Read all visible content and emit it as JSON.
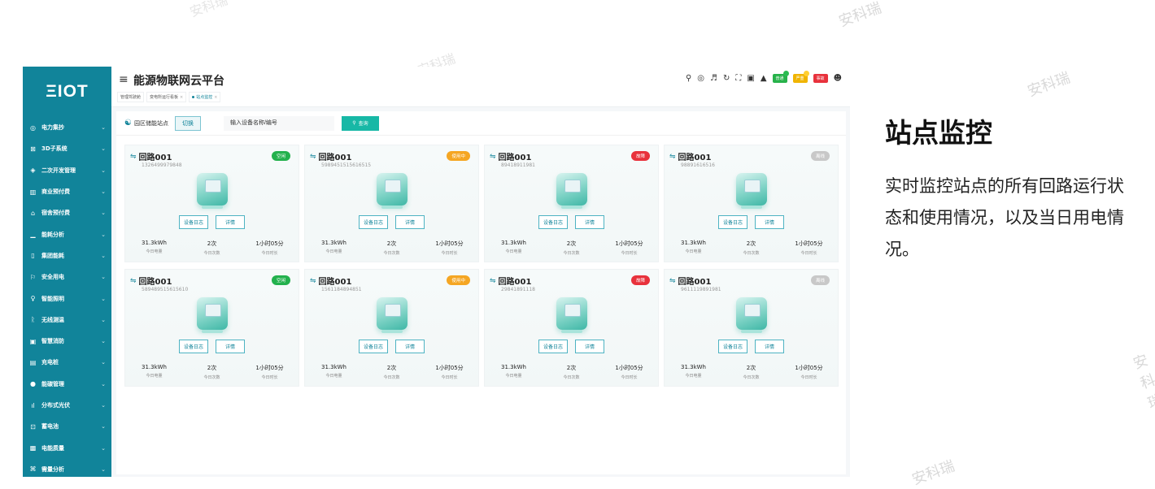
{
  "watermark": "安科瑞",
  "sidebar": {
    "logo": "ΞIOT",
    "items": [
      {
        "icon": "◎",
        "label": "电力集抄"
      },
      {
        "icon": "⊠",
        "label": "3D子系统"
      },
      {
        "icon": "◈",
        "label": "二次开发管理"
      },
      {
        "icon": "▥",
        "label": "商业预付费"
      },
      {
        "icon": "⌂",
        "label": "宿舍预付费"
      },
      {
        "icon": "▁",
        "label": "能耗分析"
      },
      {
        "icon": "▯",
        "label": "集团能耗"
      },
      {
        "icon": "⚐",
        "label": "安全用电"
      },
      {
        "icon": "♀",
        "label": "智能照明"
      },
      {
        "icon": "ᚱ",
        "label": "无线测温"
      },
      {
        "icon": "▣",
        "label": "智慧消防"
      },
      {
        "icon": "▤",
        "label": "充电桩"
      },
      {
        "icon": "●",
        "label": "能碳管理"
      },
      {
        "icon": "ıl",
        "label": "分布式光伏"
      },
      {
        "icon": "⊡",
        "label": "蓄电池"
      },
      {
        "icon": "▩",
        "label": "电能质量"
      },
      {
        "icon": "⌘",
        "label": "需量分析"
      }
    ]
  },
  "header": {
    "menu_icon": "≡",
    "title": "能源物联网云平台",
    "tabs": [
      {
        "label": "管理驾驶舱",
        "active": false,
        "closable": false
      },
      {
        "label": "变电所运行看板",
        "active": false,
        "closable": true
      },
      {
        "label": "站点监控",
        "active": true,
        "closable": true
      }
    ],
    "close_glyph": "×",
    "badges": {
      "normal": "普通",
      "serious": "严重",
      "incident": "事故"
    }
  },
  "filter": {
    "station_label": "园区储能站点",
    "switch_label": "切换",
    "search_placeholder": "输入设备名称/编号",
    "query_label": "查询"
  },
  "card_labels": {
    "log": "设备日志",
    "detail": "详情",
    "power_label": "今日电量",
    "count_label": "今日次数",
    "duration_label": "今日时长"
  },
  "cards": [
    {
      "name": "回路001",
      "id": "1326499979848",
      "status": "空闲",
      "status_key": "idle",
      "power": "31.3kWh",
      "count": "2次",
      "duration": "1小时05分"
    },
    {
      "name": "回路001",
      "id": "5989451515616515",
      "status": "使用中",
      "status_key": "inuse",
      "power": "31.3kWh",
      "count": "2次",
      "duration": "1小时05分"
    },
    {
      "name": "回路001",
      "id": "89418911981",
      "status": "故障",
      "status_key": "fault",
      "power": "31.3kWh",
      "count": "2次",
      "duration": "1小时05分"
    },
    {
      "name": "回路001",
      "id": "98891616516",
      "status": "离线",
      "status_key": "offline",
      "power": "31.3kWh",
      "count": "2次",
      "duration": "1小时05分"
    },
    {
      "name": "回路001",
      "id": "589489515615610",
      "status": "空闲",
      "status_key": "idle",
      "power": "31.3kWh",
      "count": "2次",
      "duration": "1小时05分"
    },
    {
      "name": "回路001",
      "id": "1561184894851",
      "status": "使用中",
      "status_key": "inuse",
      "power": "31.3kWh",
      "count": "2次",
      "duration": "1小时05分"
    },
    {
      "name": "回路001",
      "id": "29841891118",
      "status": "故障",
      "status_key": "fault",
      "power": "31.3kWh",
      "count": "2次",
      "duration": "1小时05分"
    },
    {
      "name": "回路001",
      "id": "9611119891981",
      "status": "离线",
      "status_key": "offline",
      "power": "31.3kWh",
      "count": "2次",
      "duration": "1小时05分"
    }
  ],
  "side": {
    "title": "站点监控",
    "description": "实时监控站点的所有回路运行状态和使用情况，以及当日用电情况。"
  }
}
